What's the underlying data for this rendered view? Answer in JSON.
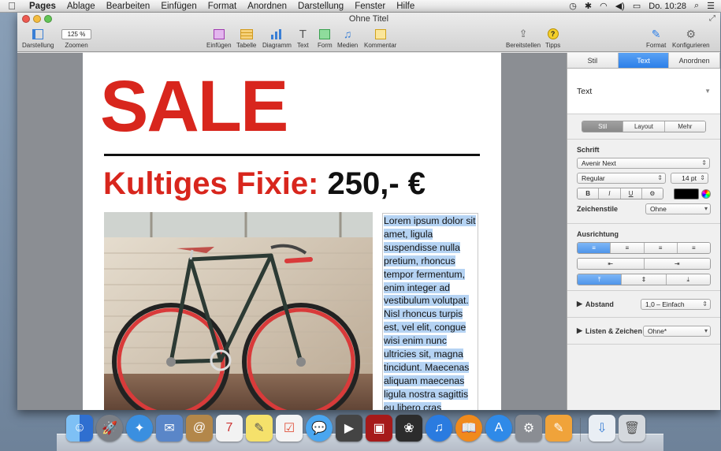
{
  "menubar": {
    "items": [
      "Pages",
      "Ablage",
      "Bearbeiten",
      "Einfügen",
      "Format",
      "Anordnen",
      "Darstellung",
      "Fenster",
      "Hilfe"
    ],
    "clock": "Do. 10:28"
  },
  "window": {
    "title": "Ohne Titel"
  },
  "toolbar": {
    "view": "Darstellung",
    "zoom_value": "125 %",
    "zoom": "Zoomen",
    "insert": "Einfügen",
    "table": "Tabelle",
    "chart": "Diagramm",
    "text": "Text",
    "shape": "Form",
    "media": "Medien",
    "comment": "Kommentar",
    "share": "Bereitstellen",
    "tips": "Tipps",
    "format": "Format",
    "setup": "Konfigurieren"
  },
  "document": {
    "headline": "SALE",
    "subhead_red": "Kultiges Fixie:",
    "subhead_price": "250,- €",
    "body": "Lorem ipsum dolor sit amet, ligula suspendisse nulla pretium, rhoncus tempor fermentum, enim integer ad vestibulum volutpat. Nisl rhoncus turpis est, vel elit, congue wisi enim nunc ultricies sit, magna tincidunt. Maecenas aliquam maecenas ligula nostra sagittis eu libero cras"
  },
  "inspector": {
    "tabs": [
      "Stil",
      "Text",
      "Anordnen"
    ],
    "active_tab": "Text",
    "paragraph_style": "Text",
    "subtabs": [
      "Stil",
      "Layout",
      "Mehr"
    ],
    "font_heading": "Schrift",
    "font_family": "Avenir Next",
    "font_weight": "Regular",
    "font_size": "14 pt",
    "bold": "B",
    "italic": "I",
    "underline": "U",
    "gear": "⚙",
    "char_styles_label": "Zeichenstile",
    "char_styles_value": "Ohne",
    "align_heading": "Ausrichtung",
    "spacing_label": "Abstand",
    "spacing_value": "1,0 – Einfach",
    "lists_label": "Listen & Zeichen",
    "lists_value": "Ohne*"
  },
  "colors": {
    "accent_red": "#d8261d",
    "selection": "#b5d3f3",
    "tab_blue": "#2c7fe8"
  }
}
